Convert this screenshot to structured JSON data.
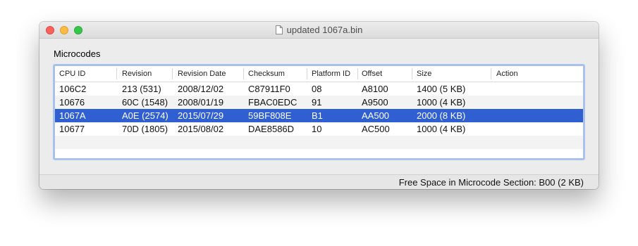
{
  "window": {
    "title": "updated 1067a.bin"
  },
  "section": {
    "label": "Microcodes"
  },
  "table": {
    "columns": [
      "CPU ID",
      "Revision",
      "Revision Date",
      "Checksum",
      "Platform ID",
      "Offset",
      "Size",
      "Action"
    ],
    "rows": [
      [
        "106C2",
        "213 (531)",
        "2008/12/02",
        "C87911F0",
        "08",
        "A8100",
        "1400 (5 KB)",
        ""
      ],
      [
        "10676",
        "60C (1548)",
        "2008/01/19",
        "FBAC0EDC",
        "91",
        "A9500",
        "1000 (4 KB)",
        ""
      ],
      [
        "1067A",
        "A0E (2574)",
        "2015/07/29",
        "59BF808E",
        "B1",
        "AA500",
        "2000 (8 KB)",
        ""
      ],
      [
        "10677",
        "70D (1805)",
        "2015/08/02",
        "DAE8586D",
        "10",
        "AC500",
        "1000 (4 KB)",
        ""
      ]
    ],
    "selected_row": "1067A"
  },
  "status": {
    "text": "Free Space in Microcode Section: B00 (2 KB)"
  },
  "colors": {
    "selection": "#2f5fd0",
    "focus_ring": "#a9c1ee",
    "close": "#fc605b",
    "minimize": "#fdbc40",
    "zoom": "#34c84a"
  }
}
